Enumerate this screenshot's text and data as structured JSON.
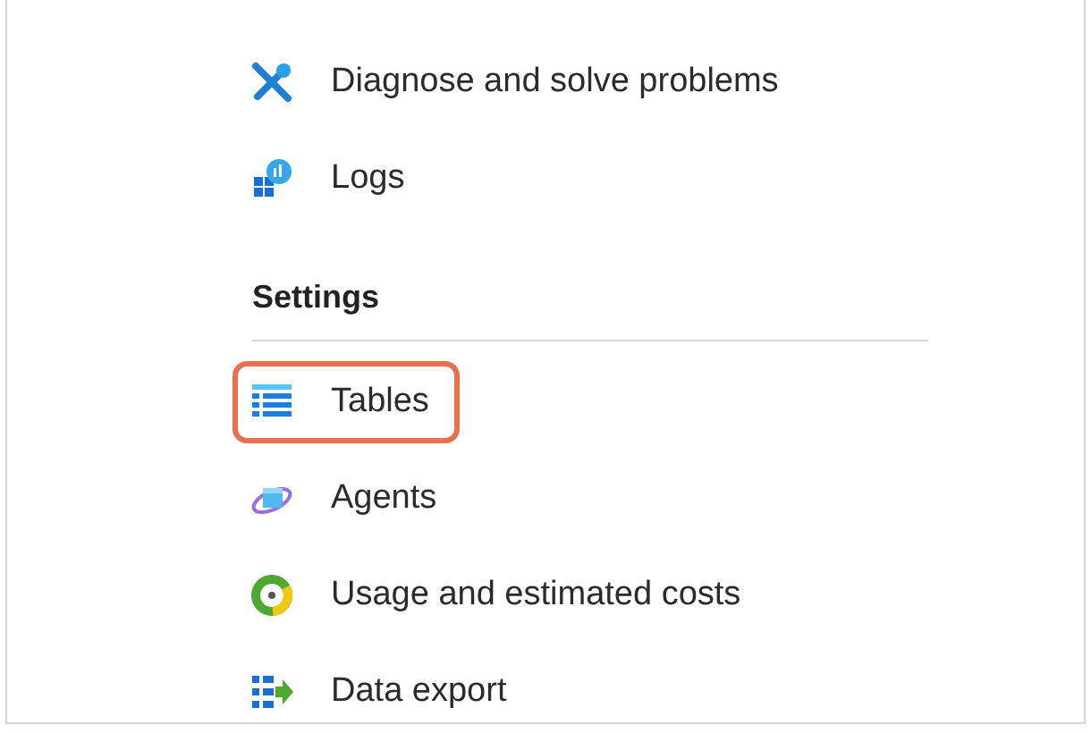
{
  "items": [
    {
      "label": "Diagnose and solve problems",
      "highlighted": false
    },
    {
      "label": "Logs",
      "highlighted": false
    }
  ],
  "section": {
    "title": "Settings",
    "items": [
      {
        "label": "Tables",
        "highlighted": true
      },
      {
        "label": "Agents",
        "highlighted": false
      },
      {
        "label": "Usage and estimated costs",
        "highlighted": false
      },
      {
        "label": "Data export",
        "highlighted": false
      }
    ]
  }
}
